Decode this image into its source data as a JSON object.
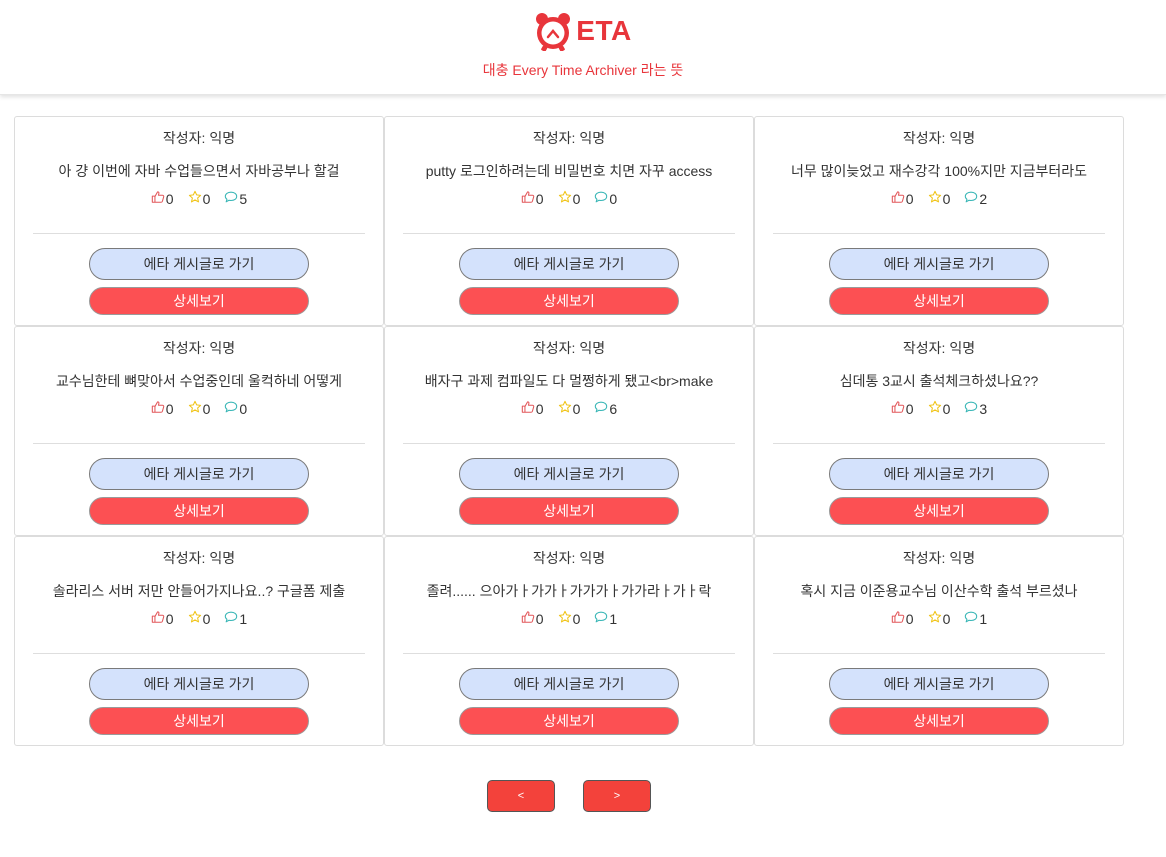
{
  "header": {
    "logo_text": "ETA",
    "tagline": "대충 Every Time Archiver 라는 뜻"
  },
  "colors": {
    "brand": "#e8353b",
    "eta_button_bg": "#d4e2fc",
    "detail_button_bg": "#fc5053",
    "pager_button_bg": "#f3423b",
    "like_icon": "#e2575a",
    "star_icon": "#f0c419",
    "comment_icon": "#3bb7b7"
  },
  "posts": [
    {
      "author": "작성자: 익명",
      "title": "아 걍 이번에 자바 수업들으면서 자바공부나 할걸",
      "likes": "0",
      "scraps": "0",
      "comments": "5",
      "eta_label": "에타 게시글로 가기",
      "detail_label": "상세보기"
    },
    {
      "author": "작성자: 익명",
      "title": "putty 로그인하려는데 비밀번호 치면 자꾸 access",
      "likes": "0",
      "scraps": "0",
      "comments": "0",
      "eta_label": "에타 게시글로 가기",
      "detail_label": "상세보기"
    },
    {
      "author": "작성자: 익명",
      "title": "너무 많이늦었고 재수강각 100%지만 지금부터라도",
      "likes": "0",
      "scraps": "0",
      "comments": "2",
      "eta_label": "에타 게시글로 가기",
      "detail_label": "상세보기"
    },
    {
      "author": "작성자: 익명",
      "title": "교수님한테 뼈맞아서 수업중인데 울컥하네 어떻게",
      "likes": "0",
      "scraps": "0",
      "comments": "0",
      "eta_label": "에타 게시글로 가기",
      "detail_label": "상세보기"
    },
    {
      "author": "작성자: 익명",
      "title": "배자구 과제 컴파일도 다 멀쩡하게 됐고<br>make",
      "likes": "0",
      "scraps": "0",
      "comments": "6",
      "eta_label": "에타 게시글로 가기",
      "detail_label": "상세보기"
    },
    {
      "author": "작성자: 익명",
      "title": "심데통 3교시 출석체크하셨나요??",
      "likes": "0",
      "scraps": "0",
      "comments": "3",
      "eta_label": "에타 게시글로 가기",
      "detail_label": "상세보기"
    },
    {
      "author": "작성자: 익명",
      "title": "솔라리스 서버 저만 안들어가지나요..? 구글폼 제출",
      "likes": "0",
      "scraps": "0",
      "comments": "1",
      "eta_label": "에타 게시글로 가기",
      "detail_label": "상세보기"
    },
    {
      "author": "작성자: 익명",
      "title": "졸려...... 으아가ㅏ가가ㅏ가가가ㅏ가가라ㅏ가ㅏ락",
      "likes": "0",
      "scraps": "0",
      "comments": "1",
      "eta_label": "에타 게시글로 가기",
      "detail_label": "상세보기"
    },
    {
      "author": "작성자: 익명",
      "title": "혹시 지금 이준용교수님 이산수학 출석 부르셨나",
      "likes": "0",
      "scraps": "0",
      "comments": "1",
      "eta_label": "에타 게시글로 가기",
      "detail_label": "상세보기"
    }
  ],
  "pagination": {
    "prev_label": "<",
    "next_label": ">"
  }
}
